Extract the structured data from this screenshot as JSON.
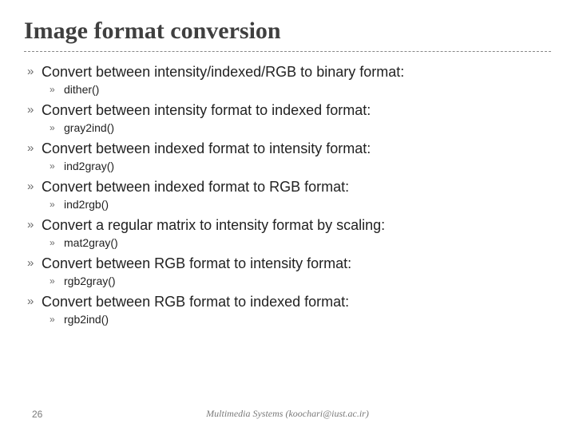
{
  "title": "Image format conversion",
  "bullet_glyph": "»",
  "items": [
    {
      "text": "Convert between intensity/indexed/RGB to binary format:",
      "sub": "dither()"
    },
    {
      "text": "Convert between intensity format to indexed format:",
      "sub": "gray2ind()"
    },
    {
      "text": "Convert between indexed format to intensity format:",
      "sub": "ind2gray()"
    },
    {
      "text": "Convert between indexed format to RGB format:",
      "sub": "ind2rgb()"
    },
    {
      "text": "Convert a regular matrix to intensity format by scaling:",
      "sub": "mat2gray()"
    },
    {
      "text": "Convert between RGB format to intensity format:",
      "sub": "rgb2gray()"
    },
    {
      "text": "Convert between RGB format to indexed format:",
      "sub": "rgb2ind()"
    }
  ],
  "footer": {
    "page": "26",
    "text": "Multimedia Systems (koochari@iust.ac.ir)"
  }
}
